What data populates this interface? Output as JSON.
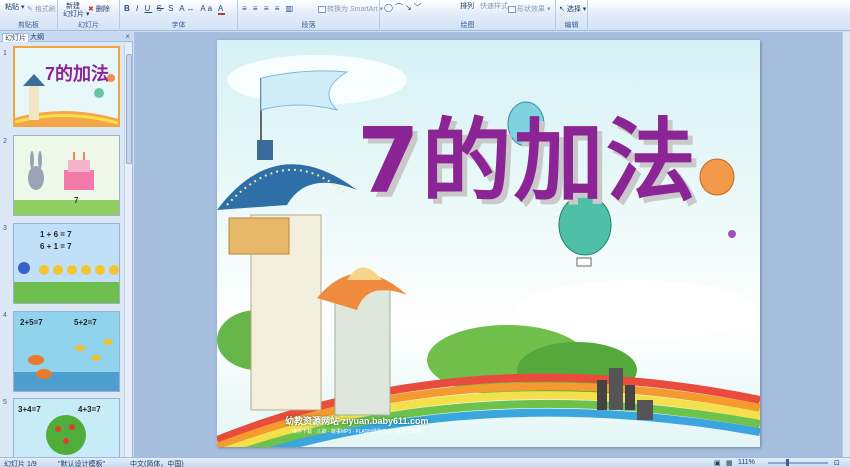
{
  "ribbon": {
    "groups": {
      "clipboard": "剪贴板",
      "slides": "幻灯片",
      "font": "字体",
      "paragraph": "段落",
      "drawing": "绘图",
      "editing": "编辑"
    },
    "paste": "粘贴",
    "format_painter": "格式刷",
    "new_slide_line1": "新建",
    "new_slide_line2": "幻灯片",
    "delete": "删除",
    "convert_smartart": "转换为 SmartArt",
    "arrange": "排列",
    "quick_styles": "快速样式",
    "shape_effects": "形状效果",
    "select": "选择"
  },
  "panel": {
    "tab_slides": "幻灯片",
    "tab_outline": "大纲",
    "close": "×",
    "thumbnails": [
      {
        "num": "1",
        "title": "7的加法"
      },
      {
        "num": "2",
        "caption": "7"
      },
      {
        "num": "3",
        "line1": "1 + 6 = 7",
        "line2": "6 + 1 = 7"
      },
      {
        "num": "4",
        "left": "2+5=7",
        "right": "5+2=7"
      },
      {
        "num": "5",
        "left": "3+4=7",
        "right": "4+3=7"
      }
    ]
  },
  "slide": {
    "title": "7的加法",
    "site_line1": "幼教资源网站 ziyuan.baby611.com",
    "site_line2": "课件下载 · 儿歌 · 故事MP3 · FLASH课件下载 · 试卷下载等"
  },
  "status": {
    "slide_info": "幻灯片 1/9",
    "theme": "\"默认设计模板\"",
    "language": "中文(简体，中国)",
    "zoom": "111%"
  },
  "colors": {
    "title": "#8b2596",
    "ribbon_bg": "#dbe7f6",
    "workspace_bg": "#a6bfde",
    "selected_border": "#f0a63c"
  }
}
